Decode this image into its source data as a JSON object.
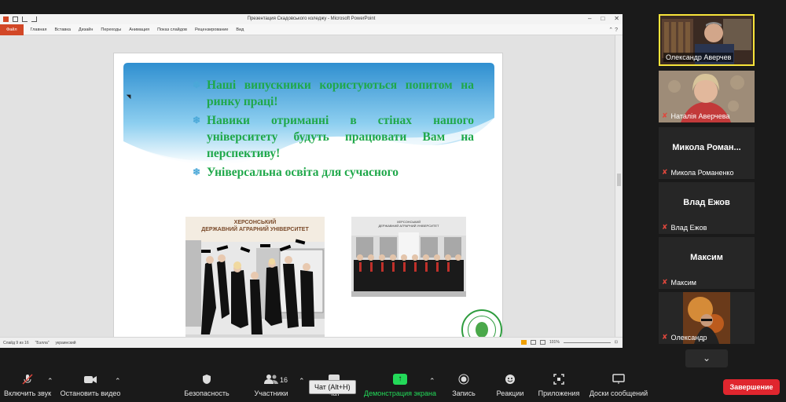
{
  "ppt": {
    "window_title": "Презентация Скадовського коледжу - Microsoft PowerPoint",
    "file_tab": "Файл",
    "ribbon_tabs": [
      "Главная",
      "Вставка",
      "Дизайн",
      "Переходы",
      "Анимация",
      "Показ слайдов",
      "Рецензирование",
      "Вид"
    ],
    "status_slide": "Слайд 9 из 16",
    "status_theme": "\"Бэлла\"",
    "status_lang": "украинский",
    "zoom": "101%"
  },
  "slide": {
    "bullets": [
      "Наші випускники користуються попитом на ринку праці!",
      "Навики отриманні в стінах нашого університету будуть працювати Вам на перспективу!",
      "Універсальна освіта для сучасного"
    ],
    "photo1_sign_line1": "ХЕРСОНСЬКИЙ",
    "photo1_sign_line2": "ДЕРЖАВНИЙ АГРАРНИЙ УНІВЕРСИТЕТ",
    "photo2_sign_line1": "ХЕРСОНСЬКИЙ",
    "photo2_sign_line2": "ДЕРЖАВНИЙ АГРАРНИЙ УНІВЕРСИТЕТ"
  },
  "participants": [
    {
      "name": "Олександр Аверчев",
      "muted": false,
      "video": true,
      "active": true
    },
    {
      "name": "Наталія Аверчева",
      "muted": true,
      "video": true,
      "active": false
    },
    {
      "name": "Микола Романенко",
      "display": "Микола Роман...",
      "muted": true,
      "video": false
    },
    {
      "name": "Влад Ежов",
      "display": "Влад Ежов",
      "muted": true,
      "video": false
    },
    {
      "name": "Максим",
      "display": "Максим",
      "muted": true,
      "video": false
    },
    {
      "name": "Олександр",
      "muted": true,
      "video": true
    }
  ],
  "toolbar": {
    "unmute": "Включить звук",
    "stop_video": "Остановить видео",
    "security": "Безопасность",
    "participants": "Участники",
    "participants_count": "16",
    "chat": "Чат",
    "share": "Демонстрация экрана",
    "record": "Запись",
    "reactions": "Реакции",
    "apps": "Приложения",
    "whiteboards": "Доски сообщений",
    "end": "Завершение",
    "chat_tooltip": "Чат (Alt+H)"
  },
  "icons": {
    "unmute": "muted-mic-icon",
    "video": "video-camera-icon",
    "security": "shield-icon",
    "participants": "people-icon",
    "chat": "chat-bubble-icon",
    "share": "share-arrow-icon",
    "record": "record-icon",
    "reactions": "smile-plus-icon",
    "apps": "apps-icon",
    "whiteboards": "whiteboard-icon"
  },
  "colors": {
    "bullet_text": "#1fa84a",
    "share_green": "#23d959",
    "end_red": "#e0262e",
    "active_speaker": "#f7e43a",
    "ppt_file_tab": "#d24726"
  }
}
